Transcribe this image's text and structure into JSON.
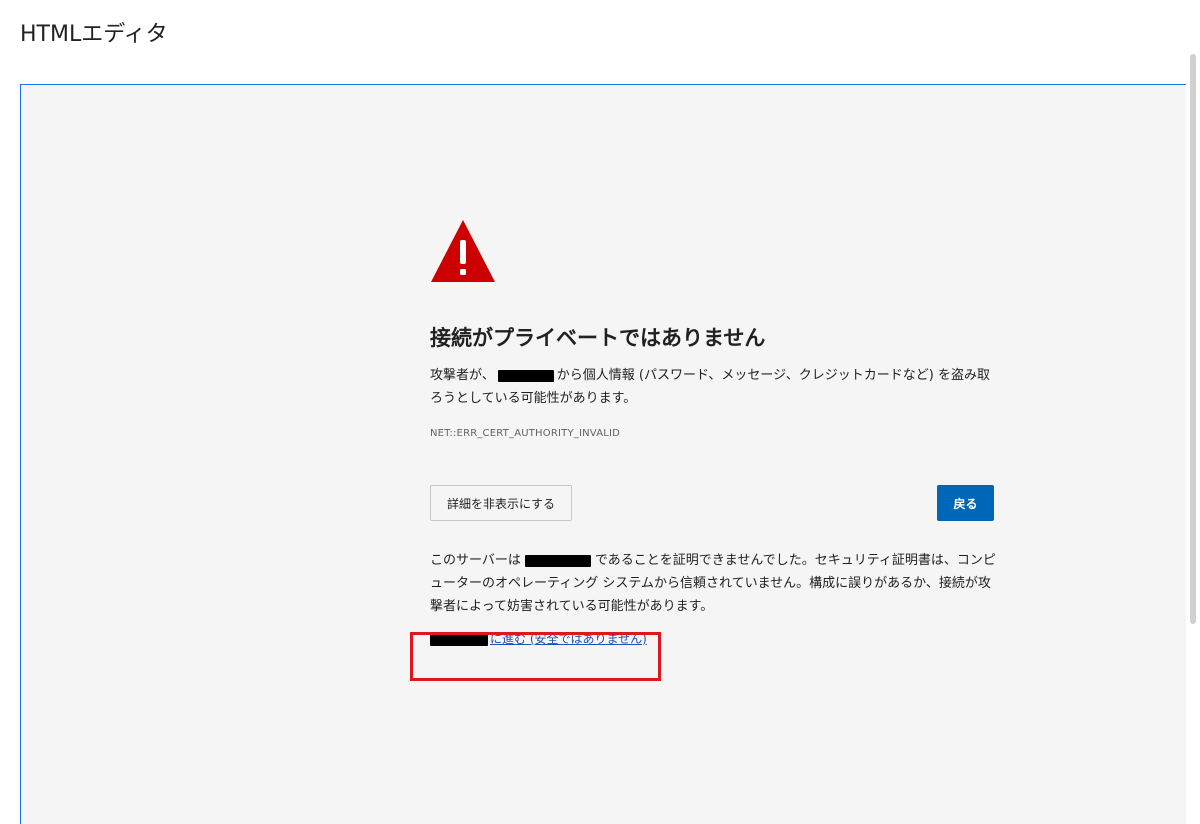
{
  "app": {
    "title": "HTMLエディタ"
  },
  "error_page": {
    "headline": "接続がプライベートではありません",
    "desc_before": "攻撃者が、",
    "desc_after": "から個人情報 (パスワード、メッセージ、クレジットカードなど) を盗み取ろうとしている可能性があります。",
    "error_code": "NET::ERR_CERT_AUTHORITY_INVALID",
    "details_button": "詳細を非表示にする",
    "back_button": "戻る",
    "detail_before": "このサーバーは",
    "detail_after": "であることを証明できませんでした。セキュリティ証明書は、コンピューターのオペレーティング システムから信頼されていません。構成に誤りがあるか、接続が攻撃者によって妨害されている可能性があります。",
    "proceed_link": "に進む (安全ではありません)",
    "icon": "warning-triangle-icon",
    "colors": {
      "warning": "#cc0000",
      "back_button": "#0067b8",
      "link": "#1a55b8",
      "highlight": "#e0161e",
      "frame_border": "#1a73e8"
    }
  }
}
